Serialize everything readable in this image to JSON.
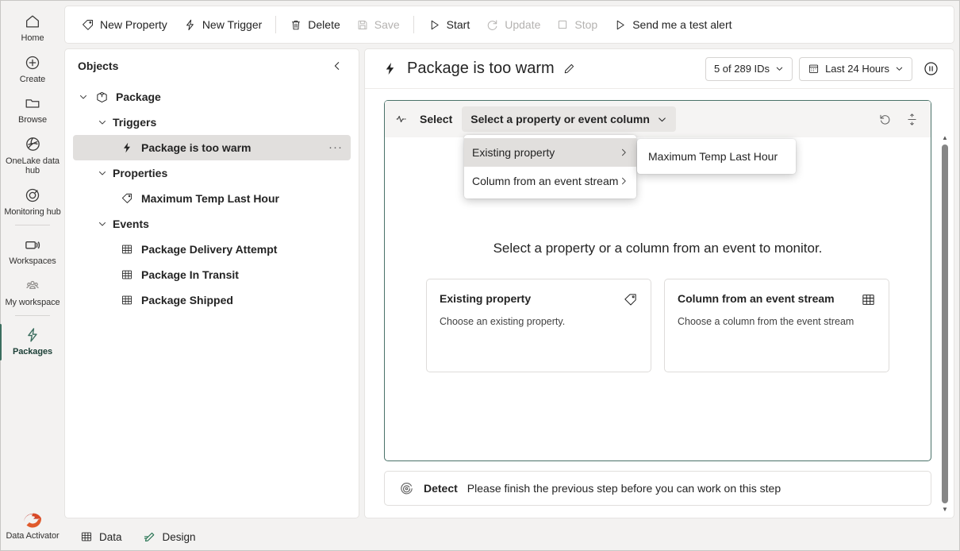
{
  "rail": {
    "items": [
      {
        "label": "Home",
        "icon": "home-icon"
      },
      {
        "label": "Create",
        "icon": "plus-circle-icon"
      },
      {
        "label": "Browse",
        "icon": "folder-icon"
      },
      {
        "label": "OneLake data hub",
        "icon": "onelake-icon"
      },
      {
        "label": "Monitoring hub",
        "icon": "monitoring-icon"
      },
      {
        "label": "Workspaces",
        "icon": "workspaces-icon"
      },
      {
        "label": "My workspace",
        "icon": "people-icon"
      },
      {
        "label": "Packages",
        "icon": "lightning-icon"
      }
    ],
    "active_index": 7,
    "product": {
      "label": "Data Activator",
      "icon": "data-activator-logo"
    },
    "accent_color": "#3b6e5f"
  },
  "toolbar": {
    "buttons": [
      {
        "label": "New Property",
        "icon": "tag-icon",
        "disabled": false
      },
      {
        "label": "New Trigger",
        "icon": "lightning-icon",
        "disabled": false
      },
      {
        "label": "Delete",
        "icon": "trash-icon",
        "disabled": false
      },
      {
        "label": "Save",
        "icon": "save-icon",
        "disabled": true
      },
      {
        "label": "Start",
        "icon": "play-icon",
        "disabled": false
      },
      {
        "label": "Update",
        "icon": "refresh-icon",
        "disabled": true
      },
      {
        "label": "Stop",
        "icon": "stop-icon",
        "disabled": true
      },
      {
        "label": "Send me a test alert",
        "icon": "play-outline-icon",
        "disabled": false
      }
    ]
  },
  "objects_panel": {
    "title": "Objects",
    "collapse_icon": "chevron-left-icon",
    "tree": [
      {
        "label": "Package",
        "level": 0,
        "icon": "package-icon",
        "expanded": true,
        "selected": false,
        "more": false
      },
      {
        "label": "Triggers",
        "level": 1,
        "icon": null,
        "expanded": true,
        "selected": false,
        "more": false
      },
      {
        "label": "Package is too warm",
        "level": 2,
        "icon": "lightning-icon",
        "expanded": null,
        "selected": true,
        "more": true
      },
      {
        "label": "Properties",
        "level": 1,
        "icon": null,
        "expanded": true,
        "selected": false,
        "more": false
      },
      {
        "label": "Maximum Temp Last Hour",
        "level": 2,
        "icon": "tag-icon",
        "expanded": null,
        "selected": false,
        "more": false
      },
      {
        "label": "Events",
        "level": 1,
        "icon": null,
        "expanded": true,
        "selected": false,
        "more": false
      },
      {
        "label": "Package Delivery Attempt",
        "level": 2,
        "icon": "table-icon",
        "expanded": null,
        "selected": false,
        "more": false
      },
      {
        "label": "Package In Transit",
        "level": 2,
        "icon": "table-icon",
        "expanded": null,
        "selected": false,
        "more": false
      },
      {
        "label": "Package Shipped",
        "level": 2,
        "icon": "table-icon",
        "expanded": null,
        "selected": false,
        "more": false
      }
    ],
    "more_glyph": "···"
  },
  "main": {
    "title": "Package is too warm",
    "title_icon": "lightning-icon",
    "edit_icon": "pencil-icon",
    "id_filter": {
      "label": "5 of 289 IDs",
      "chevron": "chevron-down-icon"
    },
    "time_filter": {
      "label": "Last 24 Hours",
      "icon": "calendar-icon",
      "chevron": "chevron-down-icon"
    },
    "pause_button": {
      "icon": "pause-circle-icon"
    },
    "select_step": {
      "step_icon": "signal-icon",
      "label": "Select",
      "dropdown_label": "Select a property or event column",
      "dropdown_chevron": "chevron-down-icon",
      "reset_icon": "reset-icon",
      "filter_icon": "split-icon",
      "border_color": "#4a7269",
      "menu": {
        "items": [
          {
            "label": "Existing property",
            "highlighted": true,
            "chevron": "chevron-right-icon"
          },
          {
            "label": "Column from an event stream",
            "highlighted": false,
            "chevron": "chevron-right-icon"
          }
        ],
        "submenu_items": [
          {
            "label": "Maximum Temp Last Hour"
          }
        ]
      },
      "empty_title": "Select a property or a column from an event to monitor.",
      "option_cards": [
        {
          "title": "Existing property",
          "description": "Choose an existing property.",
          "icon": "tag-icon"
        },
        {
          "title": "Column from an event stream",
          "description": "Choose a column from the event stream",
          "icon": "table-icon"
        }
      ]
    },
    "detect_step": {
      "icon": "target-icon",
      "label": "Detect",
      "message": "Please finish the previous step before you can work on this step"
    },
    "scrollbar": {
      "up": "▲",
      "down": "▼"
    }
  },
  "statusbar": {
    "tabs": [
      {
        "label": "Data",
        "icon": "table-icon"
      },
      {
        "label": "Design",
        "icon": "design-pencil-icon"
      }
    ]
  }
}
